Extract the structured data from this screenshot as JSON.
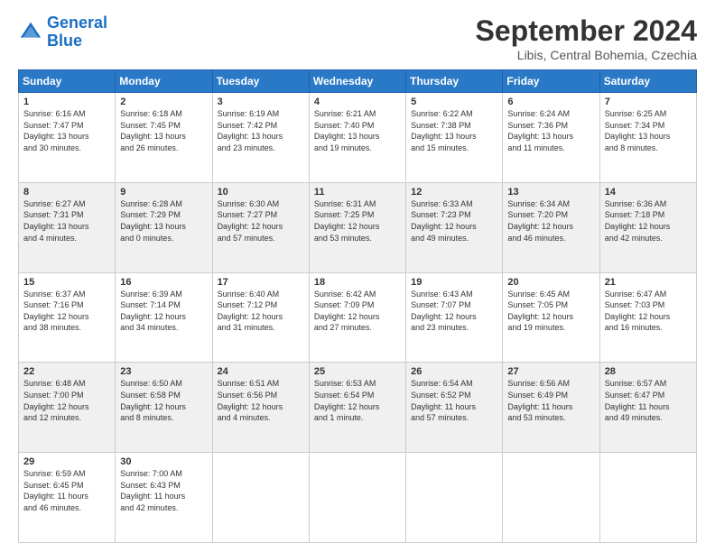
{
  "header": {
    "logo_line1": "General",
    "logo_line2": "Blue",
    "month_year": "September 2024",
    "location": "Libis, Central Bohemia, Czechia"
  },
  "days_of_week": [
    "Sunday",
    "Monday",
    "Tuesday",
    "Wednesday",
    "Thursday",
    "Friday",
    "Saturday"
  ],
  "weeks": [
    [
      {
        "day": "1",
        "info": "Sunrise: 6:16 AM\nSunset: 7:47 PM\nDaylight: 13 hours\nand 30 minutes."
      },
      {
        "day": "2",
        "info": "Sunrise: 6:18 AM\nSunset: 7:45 PM\nDaylight: 13 hours\nand 26 minutes."
      },
      {
        "day": "3",
        "info": "Sunrise: 6:19 AM\nSunset: 7:42 PM\nDaylight: 13 hours\nand 23 minutes."
      },
      {
        "day": "4",
        "info": "Sunrise: 6:21 AM\nSunset: 7:40 PM\nDaylight: 13 hours\nand 19 minutes."
      },
      {
        "day": "5",
        "info": "Sunrise: 6:22 AM\nSunset: 7:38 PM\nDaylight: 13 hours\nand 15 minutes."
      },
      {
        "day": "6",
        "info": "Sunrise: 6:24 AM\nSunset: 7:36 PM\nDaylight: 13 hours\nand 11 minutes."
      },
      {
        "day": "7",
        "info": "Sunrise: 6:25 AM\nSunset: 7:34 PM\nDaylight: 13 hours\nand 8 minutes."
      }
    ],
    [
      {
        "day": "8",
        "info": "Sunrise: 6:27 AM\nSunset: 7:31 PM\nDaylight: 13 hours\nand 4 minutes."
      },
      {
        "day": "9",
        "info": "Sunrise: 6:28 AM\nSunset: 7:29 PM\nDaylight: 13 hours\nand 0 minutes."
      },
      {
        "day": "10",
        "info": "Sunrise: 6:30 AM\nSunset: 7:27 PM\nDaylight: 12 hours\nand 57 minutes."
      },
      {
        "day": "11",
        "info": "Sunrise: 6:31 AM\nSunset: 7:25 PM\nDaylight: 12 hours\nand 53 minutes."
      },
      {
        "day": "12",
        "info": "Sunrise: 6:33 AM\nSunset: 7:23 PM\nDaylight: 12 hours\nand 49 minutes."
      },
      {
        "day": "13",
        "info": "Sunrise: 6:34 AM\nSunset: 7:20 PM\nDaylight: 12 hours\nand 46 minutes."
      },
      {
        "day": "14",
        "info": "Sunrise: 6:36 AM\nSunset: 7:18 PM\nDaylight: 12 hours\nand 42 minutes."
      }
    ],
    [
      {
        "day": "15",
        "info": "Sunrise: 6:37 AM\nSunset: 7:16 PM\nDaylight: 12 hours\nand 38 minutes."
      },
      {
        "day": "16",
        "info": "Sunrise: 6:39 AM\nSunset: 7:14 PM\nDaylight: 12 hours\nand 34 minutes."
      },
      {
        "day": "17",
        "info": "Sunrise: 6:40 AM\nSunset: 7:12 PM\nDaylight: 12 hours\nand 31 minutes."
      },
      {
        "day": "18",
        "info": "Sunrise: 6:42 AM\nSunset: 7:09 PM\nDaylight: 12 hours\nand 27 minutes."
      },
      {
        "day": "19",
        "info": "Sunrise: 6:43 AM\nSunset: 7:07 PM\nDaylight: 12 hours\nand 23 minutes."
      },
      {
        "day": "20",
        "info": "Sunrise: 6:45 AM\nSunset: 7:05 PM\nDaylight: 12 hours\nand 19 minutes."
      },
      {
        "day": "21",
        "info": "Sunrise: 6:47 AM\nSunset: 7:03 PM\nDaylight: 12 hours\nand 16 minutes."
      }
    ],
    [
      {
        "day": "22",
        "info": "Sunrise: 6:48 AM\nSunset: 7:00 PM\nDaylight: 12 hours\nand 12 minutes."
      },
      {
        "day": "23",
        "info": "Sunrise: 6:50 AM\nSunset: 6:58 PM\nDaylight: 12 hours\nand 8 minutes."
      },
      {
        "day": "24",
        "info": "Sunrise: 6:51 AM\nSunset: 6:56 PM\nDaylight: 12 hours\nand 4 minutes."
      },
      {
        "day": "25",
        "info": "Sunrise: 6:53 AM\nSunset: 6:54 PM\nDaylight: 12 hours\nand 1 minute."
      },
      {
        "day": "26",
        "info": "Sunrise: 6:54 AM\nSunset: 6:52 PM\nDaylight: 11 hours\nand 57 minutes."
      },
      {
        "day": "27",
        "info": "Sunrise: 6:56 AM\nSunset: 6:49 PM\nDaylight: 11 hours\nand 53 minutes."
      },
      {
        "day": "28",
        "info": "Sunrise: 6:57 AM\nSunset: 6:47 PM\nDaylight: 11 hours\nand 49 minutes."
      }
    ],
    [
      {
        "day": "29",
        "info": "Sunrise: 6:59 AM\nSunset: 6:45 PM\nDaylight: 11 hours\nand 46 minutes."
      },
      {
        "day": "30",
        "info": "Sunrise: 7:00 AM\nSunset: 6:43 PM\nDaylight: 11 hours\nand 42 minutes."
      },
      {
        "day": "",
        "info": ""
      },
      {
        "day": "",
        "info": ""
      },
      {
        "day": "",
        "info": ""
      },
      {
        "day": "",
        "info": ""
      },
      {
        "day": "",
        "info": ""
      }
    ]
  ]
}
